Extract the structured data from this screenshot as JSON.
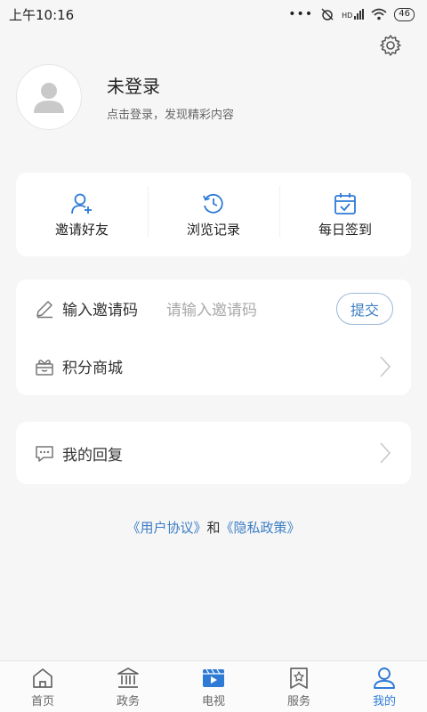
{
  "status_bar": {
    "time": "上午10:16",
    "signal": "HD",
    "battery": "46"
  },
  "profile": {
    "name": "未登录",
    "hint": "点击登录，发现精彩内容"
  },
  "quick_actions": [
    {
      "label": "邀请好友",
      "icon": "add-user-icon"
    },
    {
      "label": "浏览记录",
      "icon": "history-icon"
    },
    {
      "label": "每日签到",
      "icon": "calendar-check-icon"
    }
  ],
  "invite": {
    "label": "输入邀请码",
    "placeholder": "请输入邀请码",
    "submit": "提交"
  },
  "points_mall": {
    "label": "积分商城"
  },
  "my_replies": {
    "label": "我的回复"
  },
  "agreement": {
    "user_agreement": "《用户协议》",
    "and": "和",
    "privacy": "《隐私政策》"
  },
  "tabs": [
    {
      "label": "首页",
      "icon": "home-icon",
      "active": false
    },
    {
      "label": "政务",
      "icon": "government-icon",
      "active": false
    },
    {
      "label": "电视",
      "icon": "tv-icon",
      "active": false
    },
    {
      "label": "服务",
      "icon": "service-icon",
      "active": false
    },
    {
      "label": "我的",
      "icon": "profile-icon",
      "active": true
    }
  ],
  "colors": {
    "accent": "#2e7bd6",
    "link": "#3c7ec2",
    "background": "#f6f6f7"
  }
}
